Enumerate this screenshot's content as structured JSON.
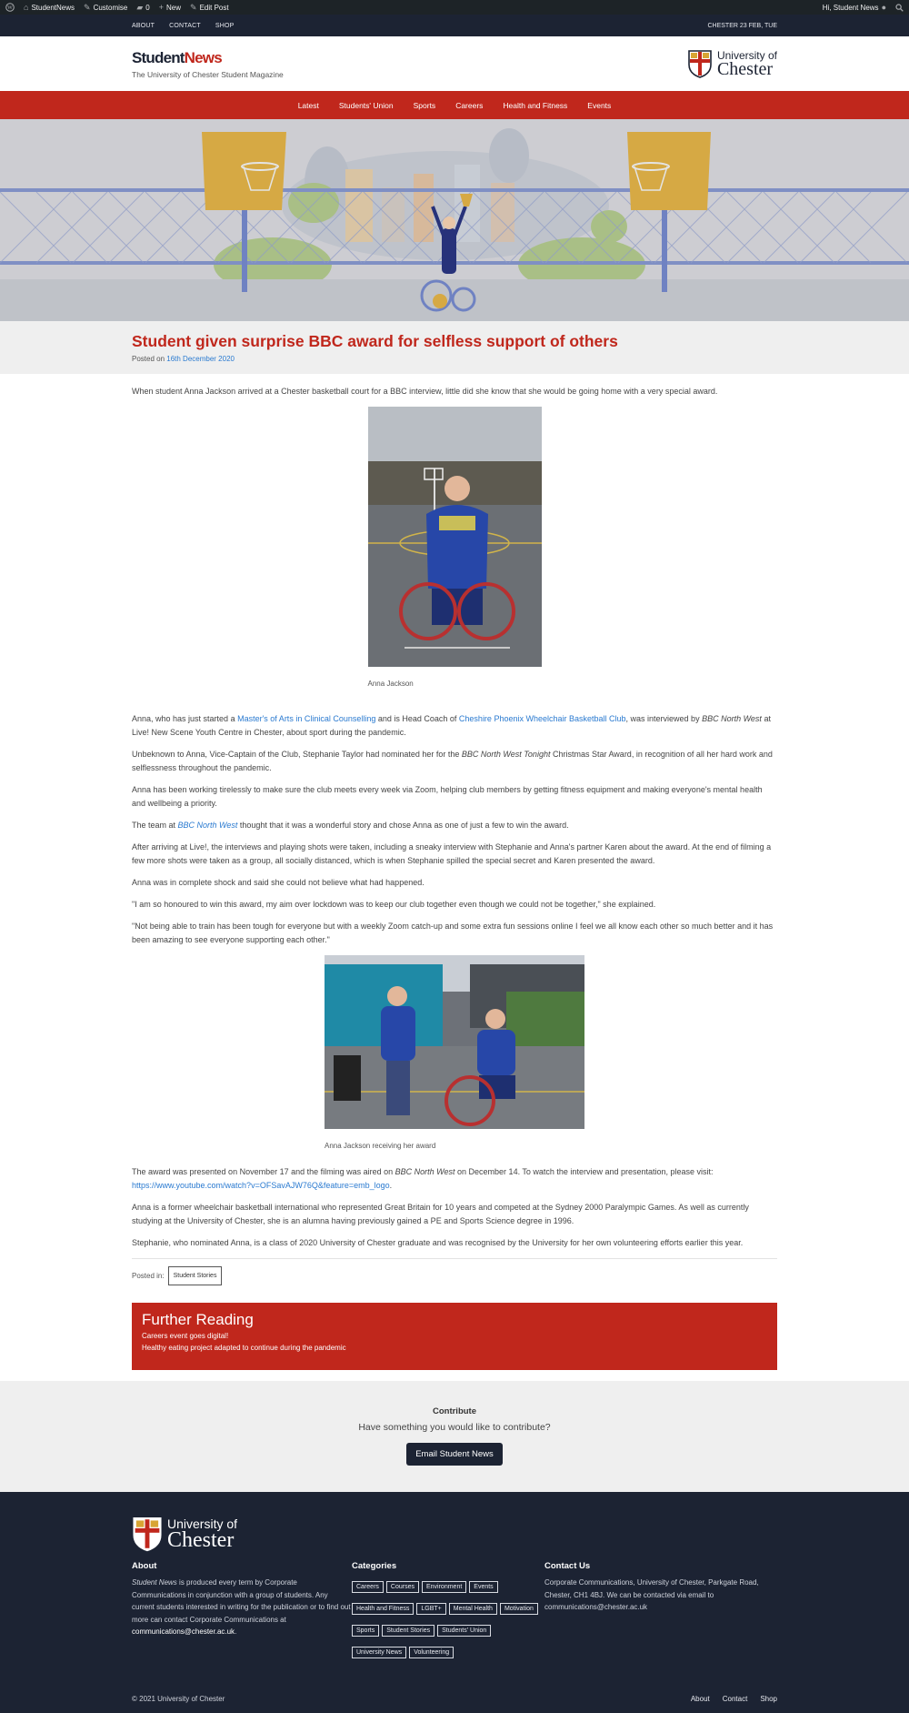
{
  "adminbar": {
    "site": "StudentNews",
    "customise": "Customise",
    "comments": "0",
    "new": "New",
    "edit": "Edit Post",
    "greeting": "Hi, Student News"
  },
  "topbar": {
    "links": [
      "ABOUT",
      "CONTACT",
      "SHOP"
    ],
    "date": "CHESTER 23 FEB, TUE"
  },
  "header": {
    "title_part1": "Student",
    "title_part2": "News",
    "subtitle": "The University of Chester Student Magazine",
    "logo_line1": "University of",
    "logo_line2": "Chester"
  },
  "nav": [
    "Latest",
    "Students' Union",
    "Sports",
    "Careers",
    "Health and Fitness",
    "Events"
  ],
  "post": {
    "title": "Student given surprise BBC award for selfless support of others",
    "posted_on": "Posted on",
    "date": "16th December 2020",
    "intro": "When student Anna Jackson arrived at a Chester basketball court for a BBC interview, little did she know that she would be going home with a very special award.",
    "fig1_caption": "Anna Jackson",
    "p1_a": "Anna, who has just started a ",
    "p1_link1": "Master's of Arts in Clinical Counselling",
    "p1_b": " and is Head Coach of ",
    "p1_link2": "Cheshire Phoenix Wheelchair Basketball Club",
    "p1_c": ", was interviewed by ",
    "p1_em": "BBC North West",
    "p1_d": " at Live! New Scene Youth Centre in Chester, about sport during the pandemic.",
    "p2_a": "Unbeknown to Anna, Vice-Captain of the Club, Stephanie Taylor had nominated her for the ",
    "p2_em": "BBC North West Tonight",
    "p2_b": " Christmas Star Award, in recognition of all her hard work and selflessness throughout the pandemic.",
    "p3": "Anna has been working tirelessly to make sure the club meets every week via Zoom, helping club members by getting fitness equipment and making everyone's mental health and wellbeing a priority.",
    "p4_a": "The team at ",
    "p4_link": "BBC North West",
    "p4_b": " thought that it was a wonderful story and chose Anna as one of just a few to win the award.",
    "p5": "After arriving at Live!, the interviews and playing shots were taken, including a sneaky interview with Stephanie and Anna's partner Karen about the award.  At the end of filming a few more shots were taken as a group, all socially distanced, which is when Stephanie spilled the special secret and Karen presented the award.",
    "p6": "Anna was in complete shock and said she could not believe what had happened.",
    "p7": "\"I am so honoured to win this award, my aim over lockdown was to keep our club together even though we could not be together,\" she explained.",
    "p8": "\"Not being able to train has been tough for everyone but with a weekly Zoom catch-up and some extra fun sessions online I feel we all know each other so much better and it has been amazing to see everyone supporting each other.\"",
    "fig2_caption": "Anna Jackson receiving her award",
    "p9_a": "The award was presented on November 17 and the filming was aired on ",
    "p9_em": "BBC North West",
    "p9_b": " on December 14. To watch the interview and presentation, please visit:",
    "p9_link": "https://www.youtube.com/watch?v=OFSavAJW76Q&feature=emb_logo",
    "p9_c": ".",
    "p10": "Anna is a former wheelchair basketball international who represented Great Britain for 10 years and competed at the Sydney 2000 Paralympic Games. As well as currently studying at the University of Chester, she is an alumna having previously gained a PE and Sports Science degree in 1996.",
    "p11": "Stephanie, who nominated Anna, is a class of 2020 University of Chester graduate and was recognised by the University for her own volunteering efforts earlier this year.",
    "posted_in": "Posted in:",
    "category": "Student Stories"
  },
  "further": {
    "title": "Further Reading",
    "items": [
      "Careers event goes digital!",
      "Healthy eating project adapted to continue during the pandemic"
    ]
  },
  "contribute": {
    "heading": "Contribute",
    "sub": "Have something you would like to contribute?",
    "button": "Email Student News"
  },
  "footer": {
    "about_title": "About",
    "about_em": "Student News",
    "about_text": " is produced every term by Corporate Communications in conjunction with a group of students. Any current students interested in writing for the publication or to find out more can contact Corporate Communications at ",
    "about_email": "communications@chester.ac.uk",
    "about_end": ".",
    "categories_title": "Categories",
    "categories": [
      "Careers",
      "Courses",
      "Environment",
      "Events",
      "Health and Fitness",
      "LGBT+",
      "Mental Health",
      "Motivation",
      "Sports",
      "Student Stories",
      "Students' Union",
      "University News",
      "Volunteering"
    ],
    "contact_title": "Contact Us",
    "contact_text": "Corporate Communications, University of Chester, Parkgate Road, Chester, CH1 4BJ. We can be contacted via email to communications@chester.ac.uk",
    "copyright": "© 2021 University of Chester",
    "bottom_links": [
      "About",
      "Contact",
      "Shop"
    ]
  },
  "colors": {
    "brand_red": "#c0271c",
    "navy": "#1c2333",
    "link": "#2a7ad0"
  }
}
